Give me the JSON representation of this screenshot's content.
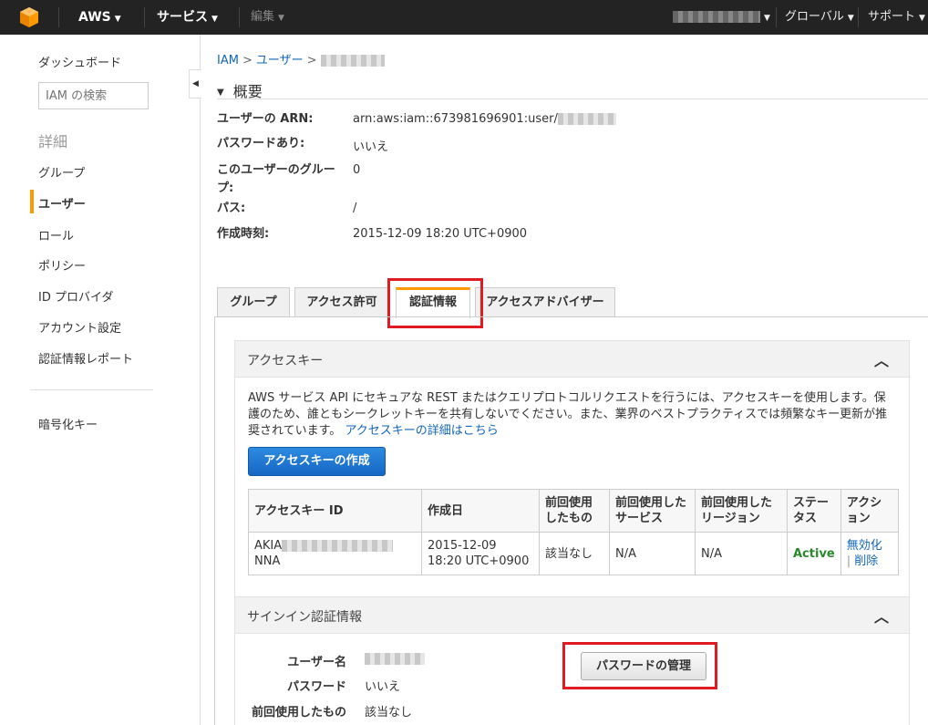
{
  "topnav": {
    "brand": "AWS",
    "services": "サービス",
    "edit": "編集",
    "region": "グローバル",
    "support": "サポート"
  },
  "sidebar": {
    "dashboard": "ダッシュボード",
    "search_placeholder": "IAM の検索",
    "details_heading": "詳細",
    "items": [
      "グループ",
      "ユーザー",
      "ロール",
      "ポリシー",
      "ID プロバイダ",
      "アカウント設定",
      "認証情報レポート"
    ],
    "encryption": "暗号化キー"
  },
  "breadcrumb": {
    "root": "IAM",
    "users": "ユーザー"
  },
  "summary": {
    "heading": "概要",
    "arn_label": "ユーザーの ARN:",
    "arn_value": "arn:aws:iam::673981696901:user/",
    "password_label": "パスワードあり:",
    "password_value": "いいえ",
    "groups_label": "このユーザーのグループ:",
    "groups_value": "0",
    "path_label": "パス:",
    "path_value": "/",
    "created_label": "作成時刻:",
    "created_value": "2015-12-09 18:20 UTC+0900"
  },
  "tabs": [
    "グループ",
    "アクセス許可",
    "認証情報",
    "アクセスアドバイザー"
  ],
  "access_keys": {
    "title": "アクセスキー",
    "desc": "AWS サービス API にセキュアな REST またはクエリプロトコルリクエストを行うには、アクセスキーを使用します。保護のため、誰ともシークレットキーを共有しないでください。また、業界のベストプラクティスでは頻繁なキー更新が推奨されています。",
    "link": "アクセスキーの詳細はこちら",
    "create_button": "アクセスキーの作成",
    "columns": [
      "アクセスキー ID",
      "作成日",
      "前回使用したもの",
      "前回使用したサービス",
      "前回使用したリージョン",
      "ステータス",
      "アクション"
    ],
    "row": {
      "key_prefix": "AKIA",
      "key_suffix": "NNA",
      "created": "2015-12-09 18:20 UTC+0900",
      "last_used": "該当なし",
      "service": "N/A",
      "region": "N/A",
      "status": "Active",
      "deactivate": "無効化",
      "delete": "削除"
    }
  },
  "signin": {
    "title": "サインイン認証情報",
    "username_label": "ユーザー名",
    "password_label": "パスワード",
    "password_value": "いいえ",
    "last_used_label": "前回使用したもの",
    "last_used_value": "該当なし",
    "manage_button": "パスワードの管理"
  },
  "colors": {
    "accent": "#ff9900",
    "highlight": "#e01b24",
    "link": "#1166bb",
    "primary": "#1666c4",
    "status_active": "#2a8a2a"
  }
}
